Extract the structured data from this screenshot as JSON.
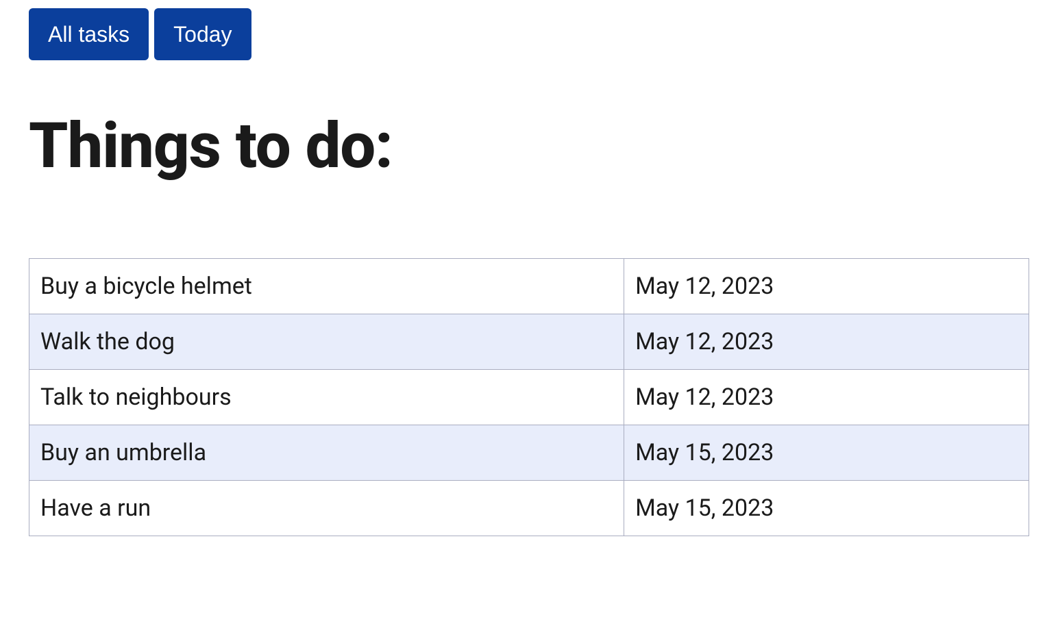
{
  "buttons": {
    "all_tasks": "All tasks",
    "today": "Today"
  },
  "heading": "Things to do:",
  "tasks": [
    {
      "name": "Buy a bicycle helmet",
      "date": "May 12, 2023"
    },
    {
      "name": "Walk the dog",
      "date": "May 12, 2023"
    },
    {
      "name": "Talk to neighbours",
      "date": "May 12, 2023"
    },
    {
      "name": "Buy an umbrella",
      "date": "May 15, 2023"
    },
    {
      "name": "Have a run",
      "date": "May 15, 2023"
    }
  ]
}
